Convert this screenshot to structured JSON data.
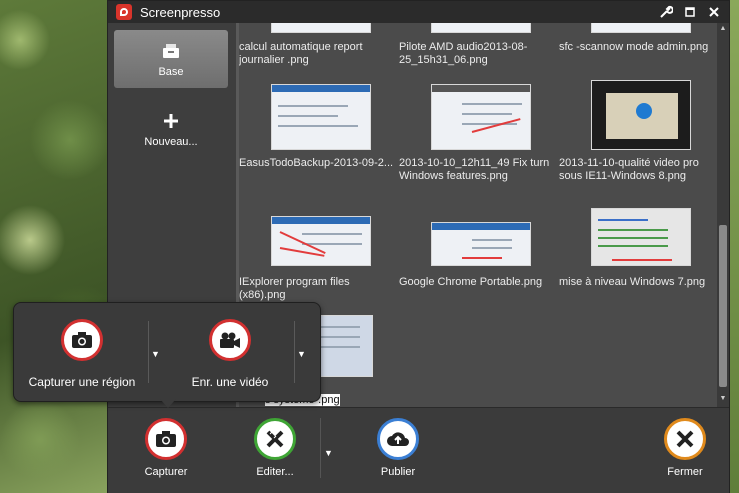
{
  "window": {
    "title": "Screenpresso",
    "controls": [
      "wrench-icon",
      "maximize-icon",
      "close-icon"
    ]
  },
  "sidebar": {
    "items": [
      {
        "label": "Base",
        "icon": "inbox-tray-icon",
        "active": true
      },
      {
        "label": "Nouveau...",
        "icon": "plus-icon",
        "active": false
      }
    ]
  },
  "gallery": {
    "items": [
      {
        "caption": "calcul automatique report journalier .png"
      },
      {
        "caption": "Pilote AMD audio2013-08-25_15h31_06.png"
      },
      {
        "caption": "sfc -scannow mode admin.png"
      },
      {
        "caption": "EasusTodoBackup-2013-09-2..."
      },
      {
        "caption": "2013-10-10_12h11_49 Fix turn Windows features.png"
      },
      {
        "caption": "2013-11-10-qualité video pro sous IE11-Windows 8.png"
      },
      {
        "caption": "IExplorer program files (x86).png"
      },
      {
        "caption": "Google Chrome Portable.png"
      },
      {
        "caption": "mise à niveau Windows 7.png"
      },
      {
        "caption": "s système-.png",
        "selected": true
      }
    ]
  },
  "capture_menu": {
    "options": [
      {
        "label": "Capturer une région",
        "icon": "camera-icon"
      },
      {
        "label": "Enr. une vidéo",
        "icon": "video-camera-icon"
      }
    ]
  },
  "toolbar": {
    "actions": [
      {
        "label": "Capturer",
        "icon": "camera-icon",
        "color": "#d23030"
      },
      {
        "label": "Editer...",
        "icon": "pencil-ruler-icon",
        "color": "#3fa535"
      },
      {
        "label": "Publier",
        "icon": "cloud-upload-icon",
        "color": "#3b7fd4"
      },
      {
        "label": "Fermer",
        "icon": "close-x-icon",
        "color": "#e08a1c"
      }
    ]
  },
  "colors": {
    "brand": "#d9342b",
    "window_bg": "#4b4b4b",
    "titlebar_bg": "#2b2b2b"
  }
}
